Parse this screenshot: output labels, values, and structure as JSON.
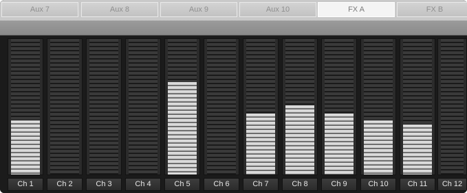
{
  "tabs": [
    {
      "label": "Aux 7",
      "active": false
    },
    {
      "label": "Aux 8",
      "active": false
    },
    {
      "label": "Aux 9",
      "active": false
    },
    {
      "label": "Aux 10",
      "active": false
    },
    {
      "label": "FX A",
      "active": true
    },
    {
      "label": "FX B",
      "active": false
    }
  ],
  "channels": [
    {
      "label": "Ch 1",
      "level": 0.4
    },
    {
      "label": "Ch 2",
      "level": 0.0
    },
    {
      "label": "Ch 3",
      "level": 0.0
    },
    {
      "label": "Ch 4",
      "level": 0.0
    },
    {
      "label": "Ch 5",
      "level": 0.68
    },
    {
      "label": "Ch 6",
      "level": 0.0
    },
    {
      "label": "Ch 7",
      "level": 0.45
    },
    {
      "label": "Ch 8",
      "level": 0.51
    },
    {
      "label": "Ch 9",
      "level": 0.45
    },
    {
      "label": "Ch 10",
      "level": 0.4
    },
    {
      "label": "Ch 11",
      "level": 0.37
    },
    {
      "label": "Ch 12",
      "level": 0.0
    }
  ],
  "colors": {
    "background": "#1b1b1b",
    "meter_lit": "#e2e2e2",
    "tab_active": "#f4f4f4"
  }
}
